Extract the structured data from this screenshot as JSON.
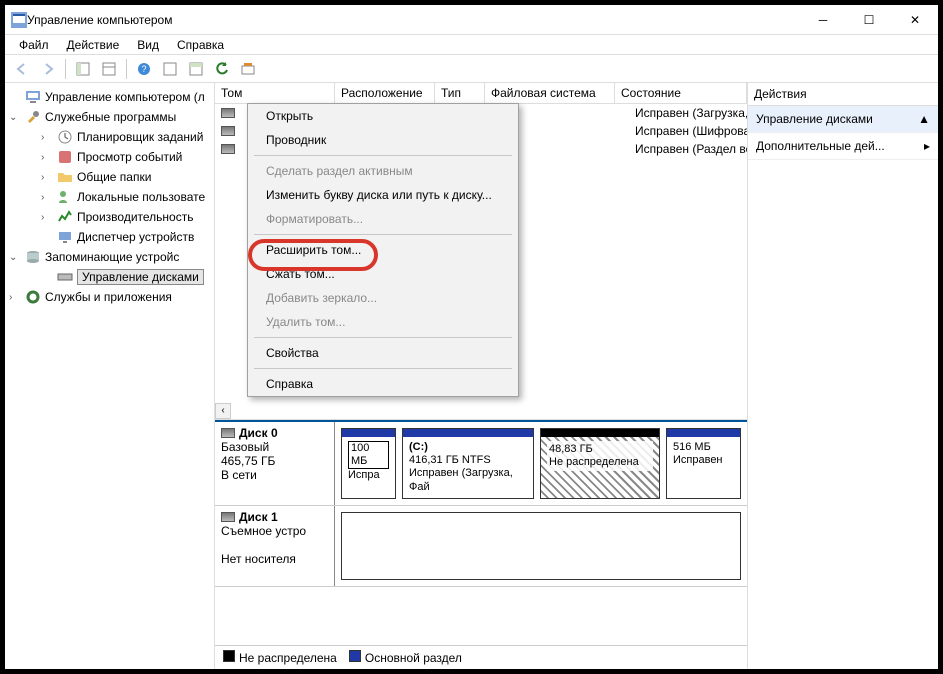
{
  "titlebar": {
    "title": "Управление компьютером"
  },
  "menu": {
    "file": "Файл",
    "action": "Действие",
    "view": "Вид",
    "help": "Справка"
  },
  "tree": {
    "root": "Управление компьютером (л",
    "tools_group": "Служебные программы",
    "scheduler": "Планировщик заданий",
    "eventviewer": "Просмотр событий",
    "shared": "Общие папки",
    "users": "Локальные пользовате",
    "perf": "Производительность",
    "devmgr": "Диспетчер устройств",
    "storage_group": "Запоминающие устройс",
    "diskmgmt": "Управление дисками",
    "services": "Службы и приложения"
  },
  "table": {
    "col_volume": "Том",
    "col_layout": "Расположение",
    "col_type": "Тип",
    "col_fs": "Файловая система",
    "col_status": "Состояние",
    "rows": [
      {
        "name": "",
        "status": "Исправен (Загрузка, Фай"
      },
      {
        "name": "",
        "status": "Исправен (Шифрованны"
      },
      {
        "name": "",
        "status": "Исправен (Раздел восста"
      }
    ]
  },
  "context_menu": {
    "open": "Открыть",
    "explorer": "Проводник",
    "make_active": "Сделать раздел активным",
    "change_letter": "Изменить букву диска или путь к диску...",
    "format": "Форматировать...",
    "extend": "Расширить том...",
    "shrink": "Сжать том...",
    "mirror": "Добавить зеркало...",
    "delete": "Удалить том...",
    "properties": "Свойства",
    "help": "Справка"
  },
  "disks": {
    "disk0": {
      "title": "Диск 0",
      "type": "Базовый",
      "size": "465,75 ГБ",
      "state": "В сети",
      "parts": [
        {
          "label": "",
          "size": "100 МБ",
          "status": "Испра",
          "color": "#1f3aa6"
        },
        {
          "label": "(C:)",
          "size": "416,31 ГБ NTFS",
          "status": "Исправен (Загрузка, Фай",
          "color": "#1f3aa6"
        },
        {
          "label": "",
          "size": "48,83 ГБ",
          "status": "Не распределена",
          "color": "#000",
          "hatched": true
        },
        {
          "label": "",
          "size": "516 МБ",
          "status": "Исправен",
          "color": "#1f3aa6"
        }
      ]
    },
    "disk1": {
      "title": "Диск 1",
      "type": "Съемное устро",
      "nomedia": "Нет носителя"
    }
  },
  "legend": {
    "unalloc": "Не распределена",
    "primary": "Основной раздел"
  },
  "actions": {
    "header": "Действия",
    "item1": "Управление дисками",
    "item2": "Дополнительные дей..."
  }
}
